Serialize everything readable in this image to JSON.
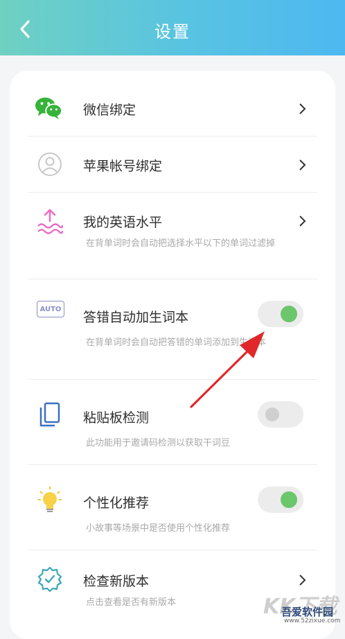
{
  "header": {
    "title": "设置"
  },
  "items": [
    {
      "label": "微信绑定"
    },
    {
      "label": "苹果帐号绑定"
    },
    {
      "label": "我的英语水平",
      "desc": "在背单词时会自动把选择水平以下的单词过滤掉"
    },
    {
      "label": "答错自动加生词本",
      "desc": "在背单词时会自动把答错的单词添加到生词本",
      "toggle": true,
      "icon_text": "AUTO"
    },
    {
      "label": "粘贴板检测",
      "desc": "此功能用于邀请码检测以获取干词豆",
      "toggle": false
    },
    {
      "label": "个性化推荐",
      "desc": "小故事等场景中是否使用个性化推荐",
      "toggle": true
    },
    {
      "label": "检查新版本",
      "desc": "点击查看是否有新版本"
    }
  ],
  "watermark": {
    "big": "KK下载",
    "mid": "吾爱软件园",
    "small": "www.52zixue.com"
  },
  "colors": {
    "accent": "#6cc66b",
    "header_start": "#6fd1c2",
    "header_end": "#4db8f0",
    "arrow": "#e0282b"
  }
}
